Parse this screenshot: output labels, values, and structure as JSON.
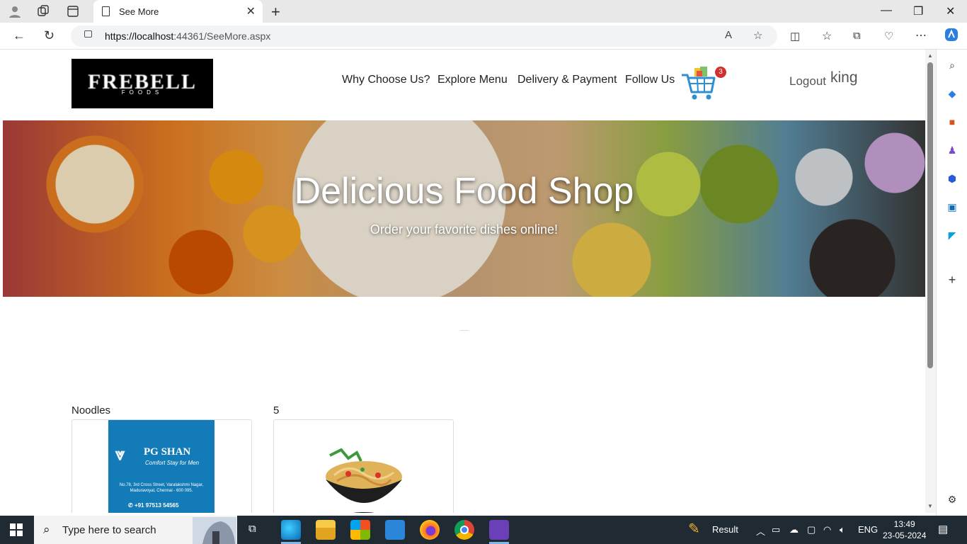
{
  "browser": {
    "tab_title": "See More",
    "url_host": "https://localhost",
    "url_rest": ":44361/SeeMore.aspx"
  },
  "site": {
    "logo_text": "FREBELL",
    "logo_sub": "FOODS",
    "nav": [
      "Why Choose Us?",
      "Explore Menu",
      "Delivery & Payment",
      "Follow Us"
    ],
    "cart_count": "3",
    "logout_label": "Logout",
    "username": "king"
  },
  "hero": {
    "title": "Delicious Food Shop",
    "subtitle": "Order your favorite dishes online!"
  },
  "products": [
    {
      "label": "Noodles",
      "card": "pg-shan"
    },
    {
      "label": "5",
      "card": "noodles-bowl"
    }
  ],
  "pg_card": {
    "name": "PG SHAN",
    "tagline": "Comfort Stay for Men",
    "address": "No.78, 3rd Cross Street, Varalakshmi Nagar, Maduravoyal, Chennai - 600 095.",
    "phone": "+91 97513 54565"
  },
  "taskbar": {
    "search_placeholder": "Type here to search",
    "result_label": "Result",
    "lang": "ENG",
    "time": "13:49",
    "date": "23-05-2024"
  },
  "colors": {
    "taskbar_bg": "#1f2a33",
    "cart_badge": "#d32f2f",
    "pg_blue": "#137bb7"
  }
}
